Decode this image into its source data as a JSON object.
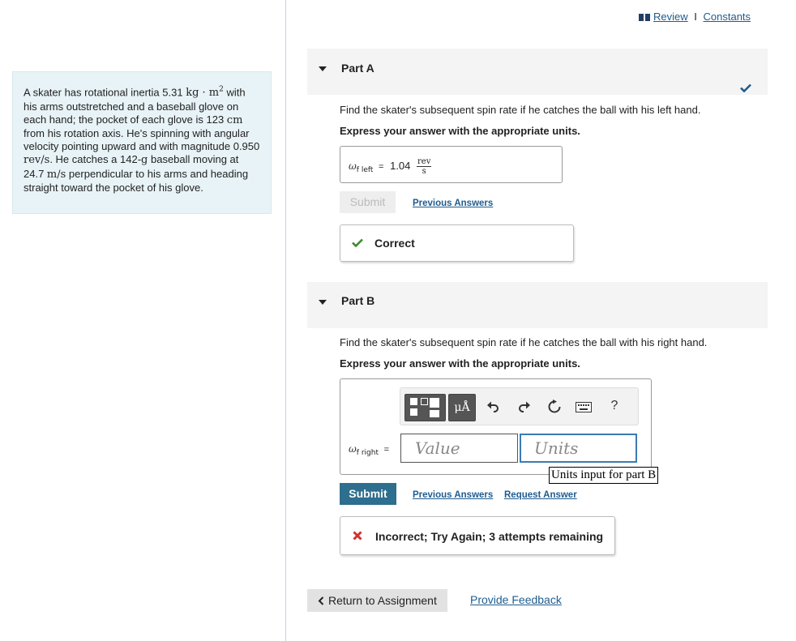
{
  "header": {
    "review": "Review",
    "separator": "I",
    "constants": "Constants"
  },
  "problem": {
    "t1": "A skater has rotational inertia 5.31 ",
    "unit_inertia": "kg · m",
    "t2": " with his arms outstretched and a baseball glove on each hand; the pocket of each glove is 123 ",
    "unit_cm": "cm",
    "t3": " from his rotation axis. He's spinning with angular velocity pointing upward and with magnitude 0.950 ",
    "unit_revs": "rev/s",
    "t4": ". He catches a 142-",
    "unit_g": "g",
    "t5": " baseball moving at 24.7 ",
    "unit_ms": "m/s",
    "t6": " perpendicular to his arms and heading straight toward the pocket of his glove."
  },
  "partA": {
    "title": "Part A",
    "question": "Find the skater's subsequent spin rate if he catches the ball with his left hand.",
    "instruction": "Express your answer with the appropriate units.",
    "var": "ω",
    "var_sub": "f left",
    "equals": "=",
    "value": "1.04",
    "unit_num": "rev",
    "unit_den": "s",
    "submit_label": "Submit",
    "prev_answers": "Previous Answers",
    "feedback": "Correct"
  },
  "partB": {
    "title": "Part B",
    "question": "Find the skater's subsequent spin rate if he catches the ball with his right hand.",
    "instruction": "Express your answer with the appropriate units.",
    "var": "ω",
    "var_sub": "f right",
    "equals": "=",
    "value_placeholder": "Value",
    "units_placeholder": "Units",
    "units_tooltip": "Units input for part B",
    "unit_tool_label": "μÅ",
    "help": "?",
    "submit_label": "Submit",
    "prev_answers": "Previous Answers",
    "request_answer": "Request Answer",
    "feedback": "Incorrect; Try Again; 3 attempts remaining"
  },
  "footer": {
    "return_label": "Return to Assignment",
    "feedback_link": "Provide Feedback"
  },
  "colors": {
    "accent": "#1f5c8f",
    "submit": "#2e6e8e",
    "correct": "#3c8a2e",
    "incorrect": "#d0312d",
    "problem_bg": "#e8f3f7"
  }
}
